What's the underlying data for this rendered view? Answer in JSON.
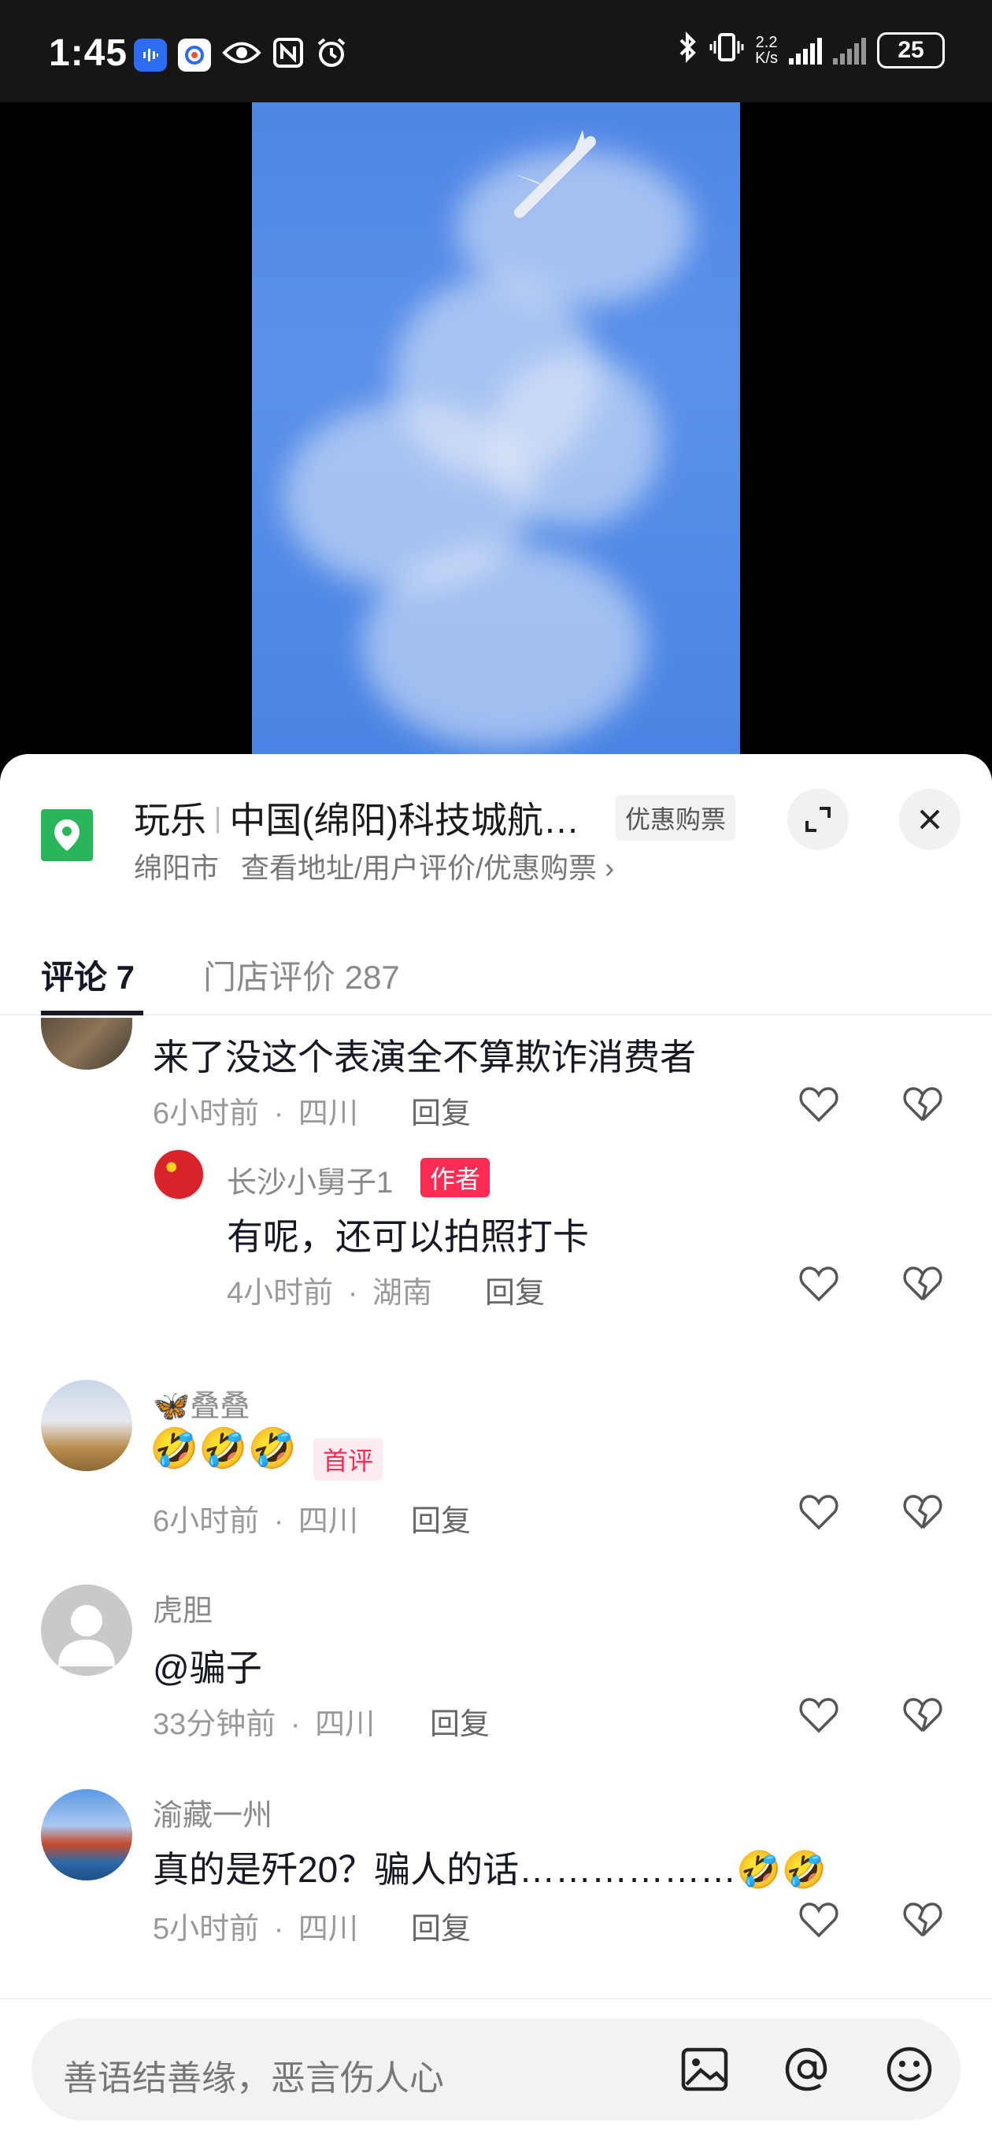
{
  "status_bar": {
    "time": "1:45",
    "net_speed_top": "2.2",
    "net_speed_bottom": "K/s",
    "battery": "25"
  },
  "poi": {
    "category": "玩乐",
    "name": "中国(绵阳)科技城航…",
    "badge": "优惠购票",
    "city": "绵阳市",
    "links": "查看地址/用户评价/优惠购票",
    "chevron": "›"
  },
  "tabs": [
    {
      "label": "评论 7"
    },
    {
      "label": "门店评价 287"
    }
  ],
  "comments": [
    {
      "username": "",
      "text": "来了没这个表演全不算欺诈消费者",
      "time": "6小时前",
      "location": "四川",
      "reply_label": "回复"
    },
    {
      "username": "长沙小舅子1",
      "author_tag": "作者",
      "text": "有呢，还可以拍照打卡",
      "time": "4小时前",
      "location": "湖南",
      "reply_label": "回复"
    },
    {
      "username": "🦋叠叠",
      "text": "🤣🤣🤣",
      "first_tag": "首评",
      "time": "6小时前",
      "location": "四川",
      "reply_label": "回复"
    },
    {
      "username": "虎胆",
      "text": "@骗子",
      "time": "33分钟前",
      "location": "四川",
      "reply_label": "回复"
    },
    {
      "username": "渝藏一州",
      "text": "真的是歼20？骗人的话………………🤣🤣",
      "time": "5小时前",
      "location": "四川",
      "reply_label": "回复"
    }
  ],
  "meta_separator": "·",
  "input": {
    "placeholder": "善语结善缘，恶言伤人心"
  },
  "colors": {
    "accent": "#fe2c55",
    "location_pin": "#2bb55a",
    "sky": "#4f86e6"
  }
}
